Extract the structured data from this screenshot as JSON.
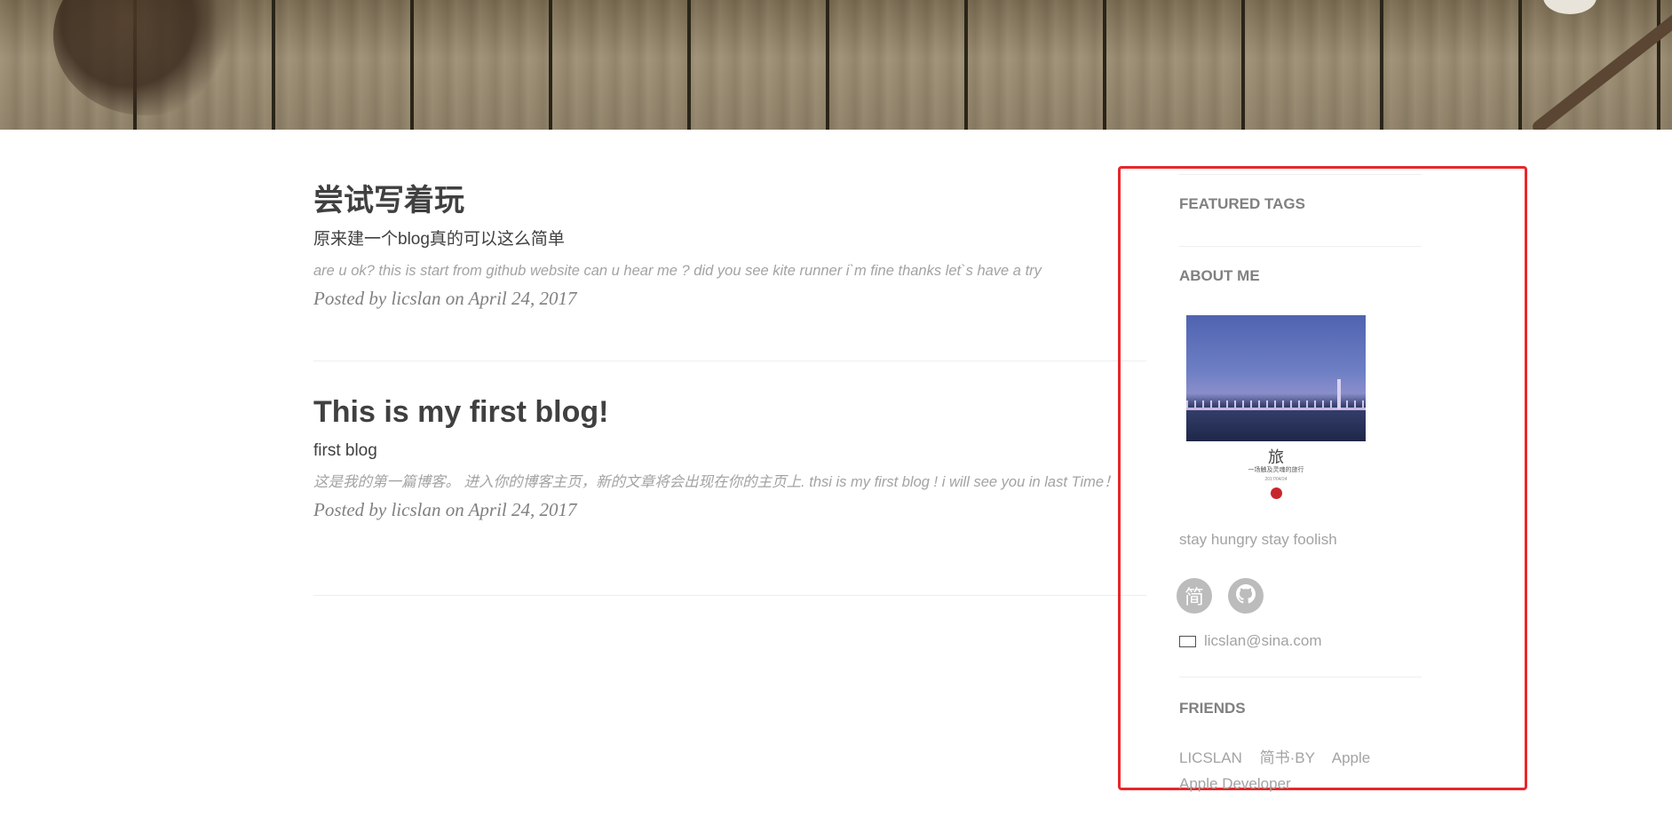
{
  "posts": [
    {
      "title": "尝试写着玩",
      "subtitle": "原来建一个blog真的可以这么简单",
      "excerpt": "are u ok? this is start from github website can u hear me ? did you see kite runner i`m fine thanks let`s have a try",
      "meta": "Posted by licslan on April 24, 2017"
    },
    {
      "title": "This is my first blog!",
      "subtitle": "first blog",
      "excerpt": "这是我的第一篇博客。 进入你的博客主页，新的文章将会出现在你的主页上. thsi is my first blog ! i will see you in last Time！",
      "meta": "Posted by licslan on April 24, 2017"
    }
  ],
  "sidebar": {
    "featured_tags_heading": "FEATURED TAGS",
    "about_me_heading": "ABOUT ME",
    "avatar": {
      "char": "旅",
      "line1": "一场触及灵魂的旅行",
      "line2": "2017/04/24"
    },
    "slogan": "stay hungry stay foolish",
    "social": [
      {
        "name": "jianshu-icon",
        "glyph": "简"
      },
      {
        "name": "github-icon",
        "glyph": ""
      }
    ],
    "email": "licslan@sina.com",
    "friends_heading": "FRIENDS",
    "friends": [
      "LICSLAN",
      "简书·BY",
      "Apple",
      "Apple Developer"
    ]
  },
  "colors": {
    "highlight_border": "#e8262a",
    "heading_gray": "#808080",
    "muted_gray": "#a3a3a3",
    "text_dark": "#404040"
  }
}
